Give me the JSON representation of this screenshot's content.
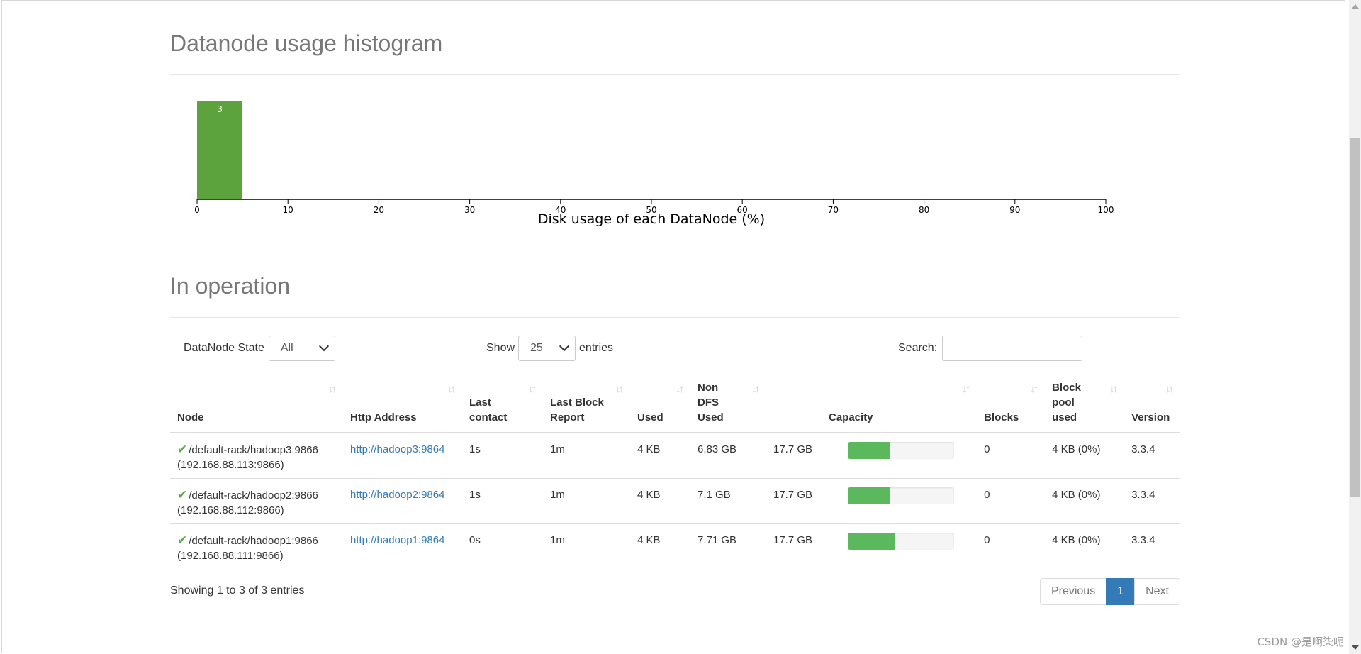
{
  "histogram": {
    "title": "Datanode usage histogram",
    "chart_data": {
      "type": "bar",
      "title": "Datanode usage histogram",
      "xlabel": "Disk usage of each DataNode (%)",
      "ylabel": "",
      "bins": [
        {
          "from": 0,
          "to": 5,
          "count": 3
        }
      ],
      "xlim": [
        0,
        100
      ],
      "xticks": [
        "0",
        "10",
        "20",
        "30",
        "40",
        "50",
        "60",
        "70",
        "80",
        "90",
        "100"
      ],
      "bar_color": "#5ca33e",
      "grid": false
    }
  },
  "operation": {
    "title": "In operation",
    "state_filter": {
      "label": "DataNode State",
      "value": "All"
    },
    "length": {
      "prefix": "Show",
      "value": "25",
      "suffix": "entries"
    },
    "search": {
      "label": "Search:",
      "value": ""
    },
    "columns": [
      {
        "label": "Node"
      },
      {
        "label": "Http Address"
      },
      {
        "label": "Last contact"
      },
      {
        "label": "Last Block Report"
      },
      {
        "label": "Used"
      },
      {
        "label": "Non DFS Used"
      },
      {
        "label": "Capacity"
      },
      {
        "label": "Blocks"
      },
      {
        "label": "Block pool used"
      },
      {
        "label": "Version"
      }
    ],
    "rows": [
      {
        "node": "/default-rack/hadoop3:9866",
        "ip": "(192.168.88.113:9866)",
        "http": "http://hadoop3:9864",
        "last_contact": "1s",
        "last_block_report": "1m",
        "used": "4 KB",
        "non_dfs_used": "6.83 GB",
        "capacity": "17.7 GB",
        "capacity_used_fraction": 0.39,
        "blocks": "0",
        "block_pool_used": "4 KB (0%)",
        "version": "3.3.4"
      },
      {
        "node": "/default-rack/hadoop2:9866",
        "ip": "(192.168.88.112:9866)",
        "http": "http://hadoop2:9864",
        "last_contact": "1s",
        "last_block_report": "1m",
        "used": "4 KB",
        "non_dfs_used": "7.1 GB",
        "capacity": "17.7 GB",
        "capacity_used_fraction": 0.4,
        "blocks": "0",
        "block_pool_used": "4 KB (0%)",
        "version": "3.3.4"
      },
      {
        "node": "/default-rack/hadoop1:9866",
        "ip": "(192.168.88.111:9866)",
        "http": "http://hadoop1:9864",
        "last_contact": "0s",
        "last_block_report": "1m",
        "used": "4 KB",
        "non_dfs_used": "7.71 GB",
        "capacity": "17.7 GB",
        "capacity_used_fraction": 0.44,
        "blocks": "0",
        "block_pool_used": "4 KB (0%)",
        "version": "3.3.4"
      }
    ],
    "info": "Showing 1 to 3 of 3 entries",
    "pagination": {
      "previous": "Previous",
      "current": "1",
      "next": "Next"
    }
  },
  "watermark": "CSDN @是啊柒呢",
  "icons": {
    "ok": "check-icon",
    "sort": "sort-icon"
  },
  "colors": {
    "link": "#337ab7",
    "progress": "#5cb85c",
    "active_page": "#337ab7"
  }
}
